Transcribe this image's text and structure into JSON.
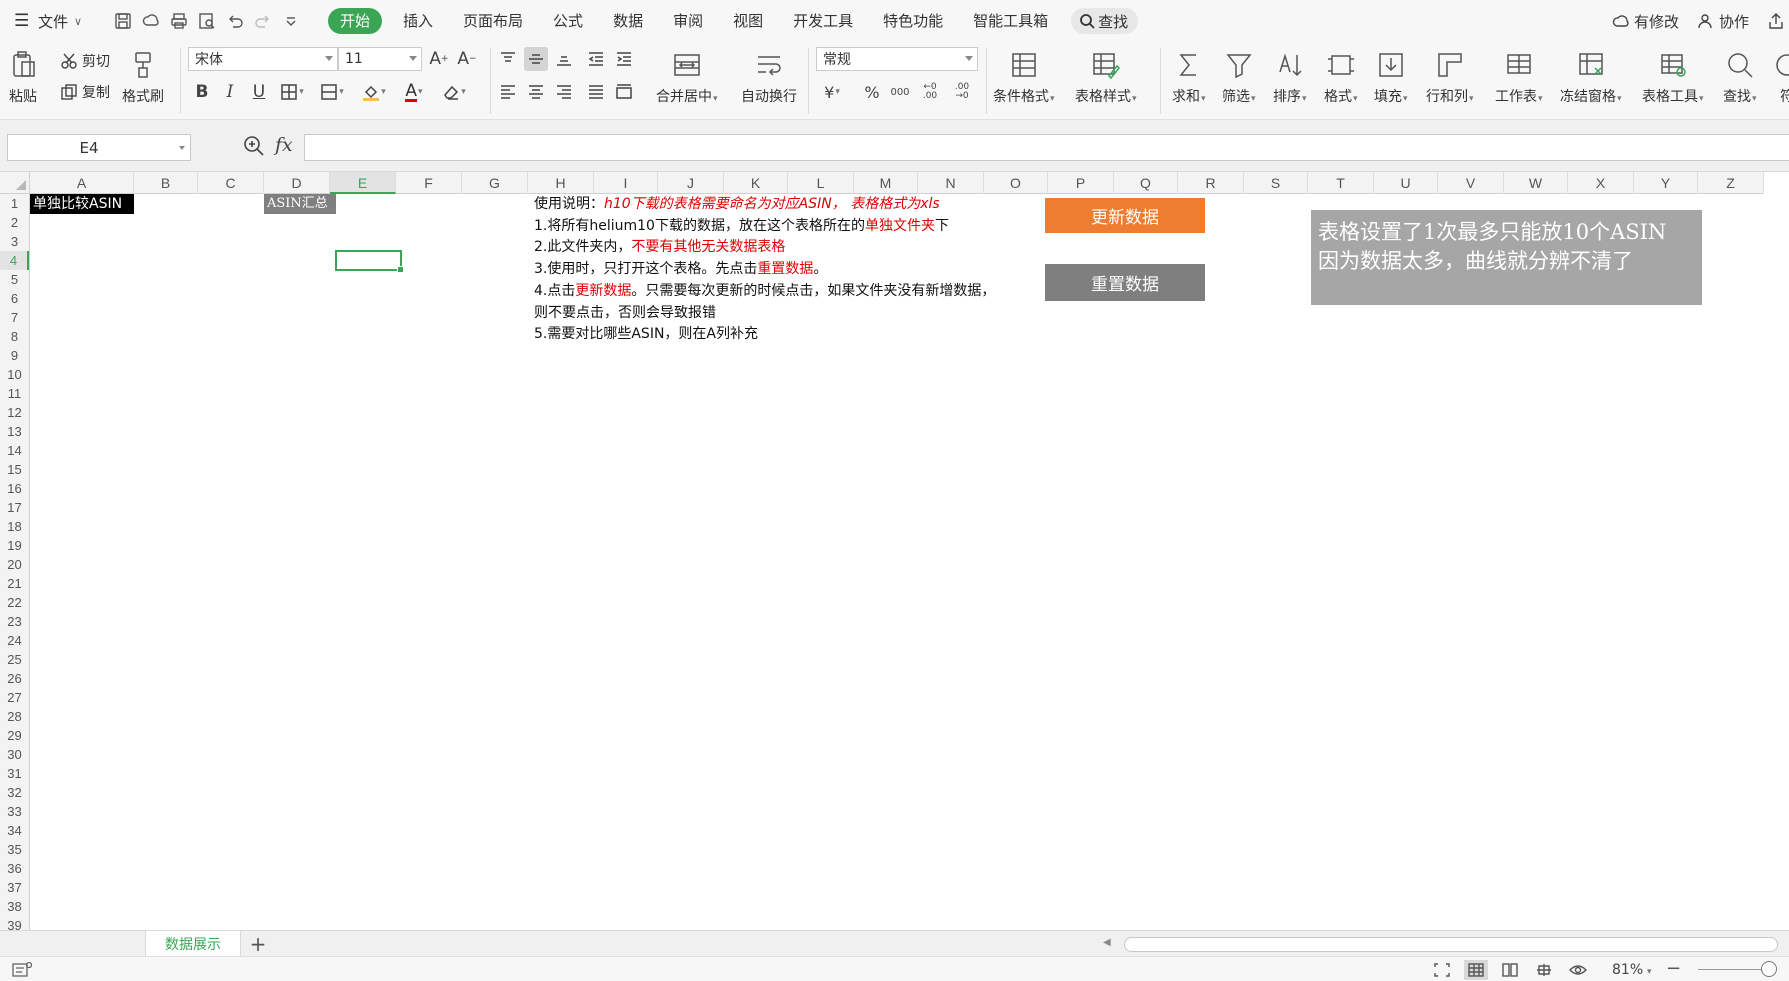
{
  "menubar": {
    "file_label": "文件",
    "tabs": [
      "开始",
      "插入",
      "页面布局",
      "公式",
      "数据",
      "审阅",
      "视图",
      "开发工具",
      "特色功能",
      "智能工具箱"
    ],
    "active_tab": "开始",
    "search_label": "查找",
    "modified_label": "有修改",
    "collab_label": "协作"
  },
  "ribbon": {
    "paste": "粘贴",
    "cut": "剪切",
    "copy": "复制",
    "format_painter": "格式刷",
    "font_name": "宋体",
    "font_size": "11",
    "merge_center": "合并居中",
    "wrap_text": "自动换行",
    "number_format": "常规",
    "conditional_format": "条件格式",
    "table_style": "表格样式",
    "sum": "求和",
    "filter": "筛选",
    "sort": "排序",
    "format": "格式",
    "fill": "填充",
    "row_col": "行和列",
    "worksheet": "工作表",
    "freeze": "冻结窗格",
    "table_tools": "表格工具",
    "find": "查找",
    "more": "符",
    "currency_symbol": "¥",
    "percent_symbol": "%",
    "thousands": "000"
  },
  "formula_bar": {
    "cell_ref": "E4",
    "fx": "fx",
    "formula": ""
  },
  "grid": {
    "columns": [
      "A",
      "B",
      "C",
      "D",
      "E",
      "F",
      "G",
      "H",
      "I",
      "J",
      "K",
      "L",
      "M",
      "N",
      "O",
      "P",
      "Q",
      "R",
      "S",
      "T",
      "U",
      "V",
      "W",
      "X",
      "Y",
      "Z"
    ],
    "rows": [
      "1",
      "2",
      "3",
      "4",
      "5",
      "6",
      "7",
      "8",
      "9",
      "10",
      "11",
      "12",
      "13",
      "14",
      "15",
      "16",
      "17",
      "18",
      "19",
      "20",
      "21",
      "22",
      "23",
      "24",
      "25",
      "26",
      "27",
      "28",
      "29",
      "30",
      "31",
      "32",
      "33",
      "34",
      "35",
      "36",
      "37",
      "38",
      "39"
    ],
    "active_col": "E",
    "active_row": "4",
    "cells": {
      "a1": "单独比较ASIN",
      "d1": "ASIN汇总"
    },
    "instructions": {
      "line1_prefix": "使用说明：",
      "line1_red": "h10下载的表格需要命名为对应ASIN，  表格格式为xls",
      "line2_a": "1.将所有helium10下载的数据，放在这个表格所在的",
      "line2_red": "单独文件夹",
      "line2_b": "下",
      "line3_a": "2.此文件夹内，",
      "line3_red": "不要有其他无关数据表格",
      "line4_a": "3.使用时，只打开这个表格。先点击",
      "line4_red": "重置数据",
      "line4_b": "。",
      "line5_a": "4.点击",
      "line5_red": "更新数据",
      "line5_b": "。只需要每次更新的时候点击，如果文件夹没有新增数据，",
      "line6": "则不要点击，否则会导致报错",
      "line7": "5.需要对比哪些ASIN，则在A列补充"
    },
    "update_button": "更新数据",
    "reset_button": "重置数据",
    "note_line1": "表格设置了1次最多只能放10个ASIN",
    "note_line2": "因为数据太多，曲线就分辨不清了"
  },
  "sheets": {
    "active": "数据展示",
    "add": "+"
  },
  "status": {
    "zoom": "81%",
    "zoom_minus": "−"
  },
  "colors": {
    "accent": "#3aa655",
    "update_button": "#ef7d31",
    "reset_button": "#7f7f7f",
    "note_box": "#a6a6a6",
    "instruction_red": "#e00000"
  }
}
